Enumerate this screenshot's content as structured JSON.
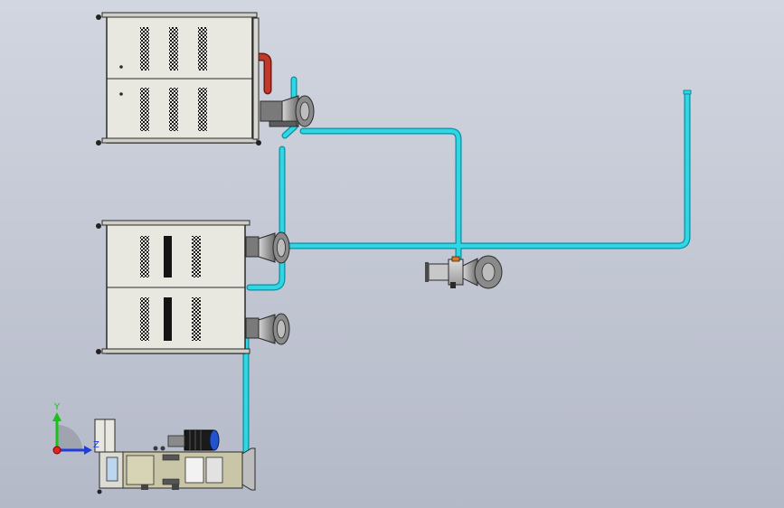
{
  "viewport": {
    "background_top": "#d2d6e0",
    "background_bottom": "#b4b9c8"
  },
  "colors": {
    "pipe": "#2fd6e4",
    "pipe_edge": "#0b8fa0",
    "hot_pipe": "#c0392b",
    "cabinet_body": "#e9e8e0",
    "cabinet_edge": "#2a2a2a",
    "vent": "#141414",
    "fan_housing": "#9a9a9a",
    "motor": "#1a1a1a",
    "motor_accent": "#2255cc",
    "axis_x": "#e52222",
    "axis_y": "#19c219",
    "axis_z": "#1f3cdc"
  },
  "equipment": {
    "cabinets": [
      "cabinet-top",
      "cabinet-middle"
    ],
    "fans": [
      "fan-top",
      "fan-middle-upper",
      "fan-middle-lower",
      "fan-standalone"
    ],
    "skid": "pump-skid-bottom"
  },
  "triad": {
    "labels": {
      "y": "Y",
      "z": "Z"
    }
  }
}
